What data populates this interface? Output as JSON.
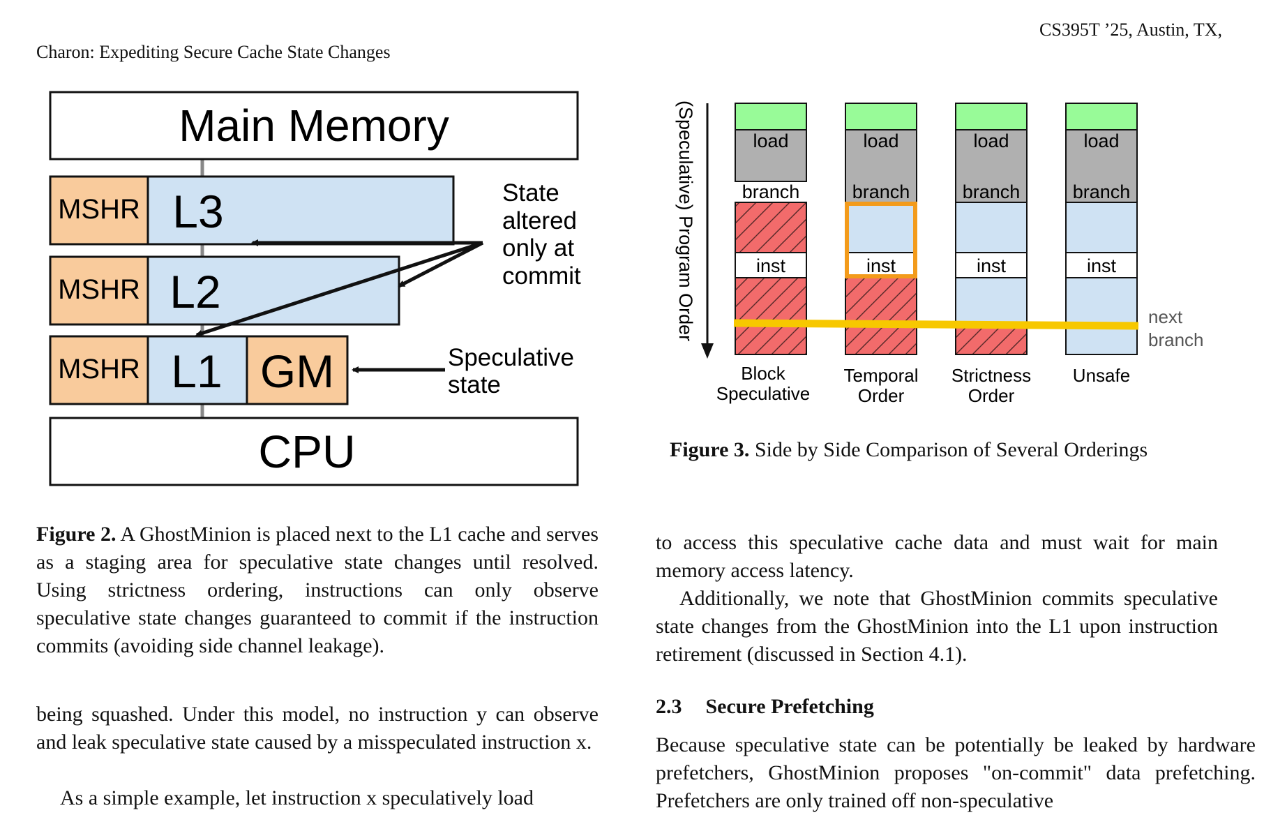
{
  "header": {
    "left": "Charon: Expediting Secure Cache State Changes",
    "right": "CS395T ’25, Austin, TX,"
  },
  "figure2": {
    "main_memory": "Main Memory",
    "mshr": "MSHR",
    "l3": "L3",
    "l2": "L2",
    "l1": "L1",
    "gm": "GM",
    "cpu": "CPU",
    "note_state": [
      "State",
      "altered",
      "only at",
      "commit"
    ],
    "note_spec": [
      "Speculative",
      "state"
    ],
    "caption_label": "Figure 2.",
    "caption_text": " A GhostMinion is placed next to the L1 cache and serves as a staging area for speculative state changes until resolved. Using strictness ordering, instructions can only observe speculative state changes guaranteed to commit if the instruction commits (avoiding side channel leakage).",
    "colors": {
      "cache": "#cfe2f3",
      "mshr": "#f9cb9c"
    }
  },
  "figure3": {
    "y_axis": "(Speculative) Program Order",
    "columns": [
      {
        "label": [
          "Block",
          "Speculative"
        ],
        "inst_mid": "hatched",
        "after": "hatched",
        "highlight": false
      },
      {
        "label": [
          "Temporal",
          "Order"
        ],
        "inst_mid": "blue",
        "after": "hatched",
        "highlight": true
      },
      {
        "label": [
          "Strictness",
          "Order"
        ],
        "inst_mid": "blue",
        "after": "split",
        "highlight": false
      },
      {
        "label": [
          "Unsafe"
        ],
        "inst_mid": "blue",
        "after": "blue",
        "highlight": false
      }
    ],
    "load": "load",
    "branch": "branch",
    "inst": "inst",
    "next_branch": [
      "next",
      "branch"
    ],
    "caption_label": "Figure 3.",
    "caption_text": " Side by Side Comparison of Several Orderings",
    "colors": {
      "green": "#98fb98",
      "gray": "#b0b0b0",
      "red": "#f26b6b",
      "blue": "#cfe2f3",
      "yellow": "#f7c800",
      "orange": "#f39b1b"
    }
  },
  "body": {
    "left_p1": "being squashed. Under this model, no instruction y can observe and leak speculative state caused by a misspeculated instruction x.",
    "left_p2": "As a simple example, let instruction x speculatively load",
    "right_p1": "to access this speculative cache data and must wait for main memory access latency.",
    "right_p2": "Additionally, we note that GhostMinion commits speculative state changes from the GhostMinion into the L1 upon instruction retirement (discussed in Section 4.1).",
    "section_num": "2.3",
    "section_title": "Secure Prefetching",
    "right_p3": "Because speculative state can be potentially be leaked by hardware prefetchers, GhostMinion proposes \"on-commit\" data prefetching. Prefetchers are only trained off non-speculative"
  }
}
